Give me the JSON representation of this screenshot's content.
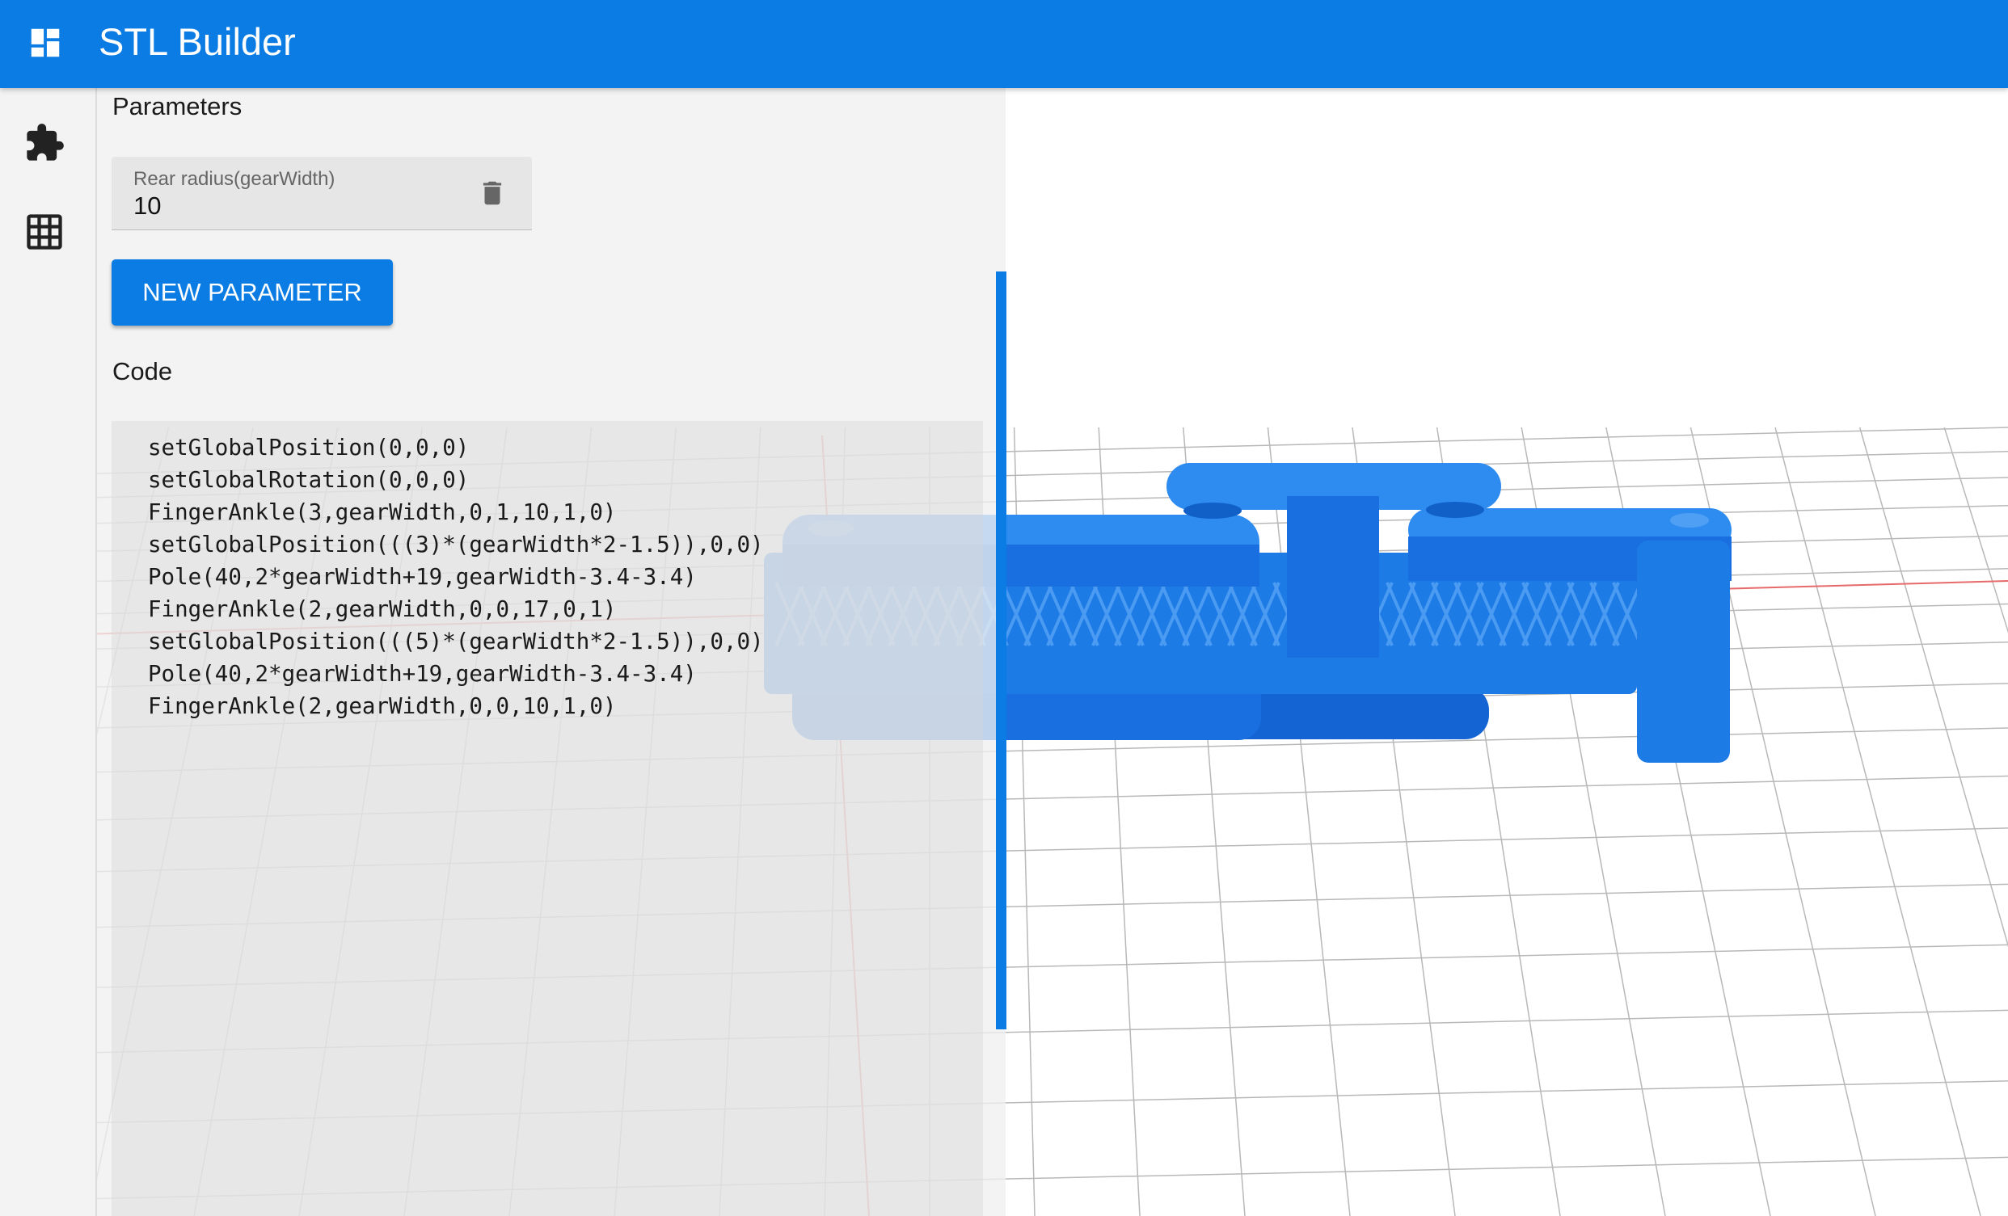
{
  "app": {
    "title": "STL Builder"
  },
  "icons": {
    "app": "dashboard-icon",
    "rail": [
      "puzzle-icon",
      "grid-icon"
    ],
    "delete": "trash-icon"
  },
  "colors": {
    "accent": "#0a7ce3",
    "model": "#1d7be6"
  },
  "parameters": {
    "heading": "Parameters",
    "items": [
      {
        "label": "Rear radius(gearWidth)",
        "value": "10"
      }
    ],
    "new_button_label": "NEW PARAMETER"
  },
  "code": {
    "heading": "Code",
    "lines": [
      "setGlobalPosition(0,0,0)",
      "setGlobalRotation(0,0,0)",
      "FingerAnkle(3,gearWidth,0,1,10,1,0)",
      "setGlobalPosition(((3)*(gearWidth*2-1.5)),0,0)",
      "Pole(40,2*gearWidth+19,gearWidth-3.4-3.4)",
      "FingerAnkle(2,gearWidth,0,0,17,0,1)",
      "setGlobalPosition(((5)*(gearWidth*2-1.5)),0,0)",
      "Pole(40,2*gearWidth+19,gearWidth-3.4-3.4)",
      "FingerAnkle(2,gearWidth,0,0,10,1,0)"
    ]
  }
}
